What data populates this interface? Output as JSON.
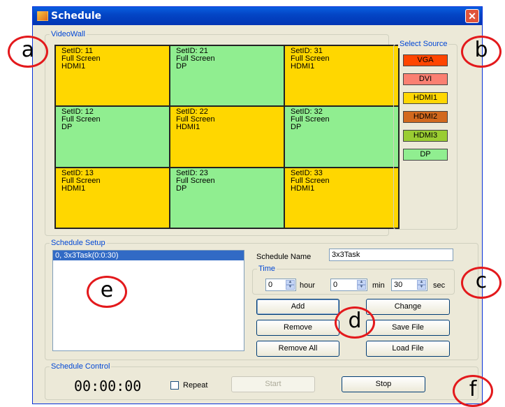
{
  "window": {
    "title": "Schedule",
    "close_glyph": "✕"
  },
  "videowall": {
    "label": "VideoWall",
    "cells": [
      {
        "id": "SetID: 11",
        "mode": "Full Screen",
        "src": "HDMI1",
        "color": "#ffd700"
      },
      {
        "id": "SetID: 21",
        "mode": "Full Screen",
        "src": "DP",
        "color": "#90ee90"
      },
      {
        "id": "SetID: 31",
        "mode": "Full Screen",
        "src": "HDMI1",
        "color": "#ffd700"
      },
      {
        "id": "SetID: 12",
        "mode": "Full Screen",
        "src": "DP",
        "color": "#90ee90"
      },
      {
        "id": "SetID: 22",
        "mode": "Full Screen",
        "src": "HDMI1",
        "color": "#ffd700"
      },
      {
        "id": "SetID: 32",
        "mode": "Full Screen",
        "src": "DP",
        "color": "#90ee90"
      },
      {
        "id": "SetID: 13",
        "mode": "Full Screen",
        "src": "HDMI1",
        "color": "#ffd700"
      },
      {
        "id": "SetID: 23",
        "mode": "Full Screen",
        "src": "DP",
        "color": "#90ee90"
      },
      {
        "id": "SetID: 33",
        "mode": "Full Screen",
        "src": "HDMI1",
        "color": "#ffd700"
      }
    ]
  },
  "select_source": {
    "label": "Select Source",
    "sources": [
      {
        "name": "VGA",
        "color": "#ff4500"
      },
      {
        "name": "DVI",
        "color": "#fa8072"
      },
      {
        "name": "HDMI1",
        "color": "#ffd700"
      },
      {
        "name": "HDMI2",
        "color": "#d2691e"
      },
      {
        "name": "HDMI3",
        "color": "#9acd32"
      },
      {
        "name": "DP",
        "color": "#90ee90"
      }
    ]
  },
  "schedule_setup": {
    "label": "Schedule Setup",
    "list_items": [
      "0, 3x3Task(0:0:30)"
    ],
    "name_label": "Schedule Name",
    "name_value": "3x3Task",
    "time_label": "Time",
    "hour_value": "0",
    "hour_label": "hour",
    "min_value": "0",
    "min_label": "min",
    "sec_value": "30",
    "sec_label": "sec",
    "buttons": {
      "add": "Add",
      "change": "Change",
      "remove": "Remove",
      "save_file": "Save File",
      "remove_all": "Remove All",
      "load_file": "Load File"
    }
  },
  "schedule_control": {
    "label": "Schedule Control",
    "timer": "00:00:00",
    "repeat_label": "Repeat",
    "start_label": "Start",
    "stop_label": "Stop"
  },
  "annotations": [
    "a",
    "b",
    "c",
    "d",
    "e",
    "f"
  ]
}
